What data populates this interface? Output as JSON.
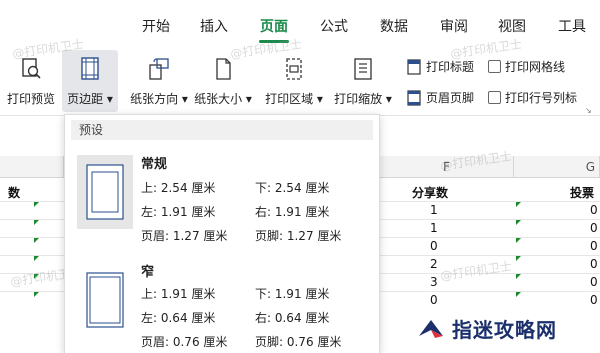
{
  "tabs": [
    {
      "label": "开始"
    },
    {
      "label": "插入"
    },
    {
      "label": "页面"
    },
    {
      "label": "公式"
    },
    {
      "label": "数据"
    },
    {
      "label": "审阅"
    },
    {
      "label": "视图"
    },
    {
      "label": "工具"
    }
  ],
  "ribbon": {
    "print_preview": "打印预览",
    "margins": "页边距",
    "orientation": "纸张方向",
    "size": "纸张大小",
    "print_area": "打印区域",
    "print_scale": "打印缩放",
    "print_titles": "打印标题",
    "header_footer": "页眉页脚",
    "gridlines": "打印网格线",
    "row_col_headers": "打印行号列标"
  },
  "sheet": {
    "col_f": "F",
    "col_g": "G",
    "left_header": "数",
    "share_header": "分享数",
    "vote_header": "投票",
    "share_values": [
      "1",
      "1",
      "0",
      "2",
      "3",
      "0"
    ],
    "vote_values": [
      "0",
      "0",
      "0",
      "0",
      "0",
      "0"
    ]
  },
  "panel": {
    "section": "预设",
    "presets": [
      {
        "name": "常规",
        "top": "上: 2.54 厘米",
        "bottom": "下: 2.54 厘米",
        "left": "左: 1.91 厘米",
        "right": "右: 1.91 厘米",
        "header": "页眉: 1.27 厘米",
        "footer": "页脚: 1.27 厘米"
      },
      {
        "name": "窄",
        "top": "上: 1.91 厘米",
        "bottom": "下: 1.91 厘米",
        "left": "左: 0.64 厘米",
        "right": "右: 0.64 厘米",
        "header": "页眉: 0.76 厘米",
        "footer": "页脚: 0.76 厘米"
      }
    ]
  },
  "watermark": "@打印机卫士",
  "logo": "指迷攻略网",
  "colors": {
    "accent": "#1a8a4a",
    "logo": "#1a2f6b"
  }
}
